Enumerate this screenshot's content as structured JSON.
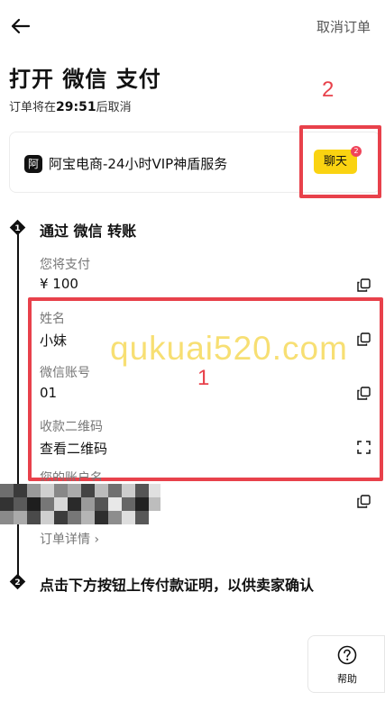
{
  "header": {
    "cancel_label": "取消订单",
    "title": "打开 微信 支付",
    "countdown_prefix": "订单将在",
    "countdown_time": "29:51",
    "countdown_suffix": "后取消"
  },
  "seller": {
    "badge": "阿",
    "name": "阿宝电商-24小时VIP神盾服务",
    "chat_label": "聊天",
    "chat_unread": "2"
  },
  "annotations": {
    "label_1": "1",
    "label_2": "2"
  },
  "steps": [
    {
      "number": "1",
      "label": "通过 微信 转账"
    },
    {
      "number": "2",
      "label": "点击下方按钮上传付款证明，以供卖家确认"
    }
  ],
  "payment": {
    "amount_label": "您将支付",
    "amount_value": "¥ 100",
    "name_label": "姓名",
    "name_value": "小妹",
    "account_label": "微信账号",
    "account_value": "01",
    "qr_label": "收款二维码",
    "qr_value": "查看二维码",
    "account_name_label": "您的账户名"
  },
  "order_details_label": "订单详情 ›",
  "watermark": "qukuai520.com",
  "help_label": "帮助"
}
